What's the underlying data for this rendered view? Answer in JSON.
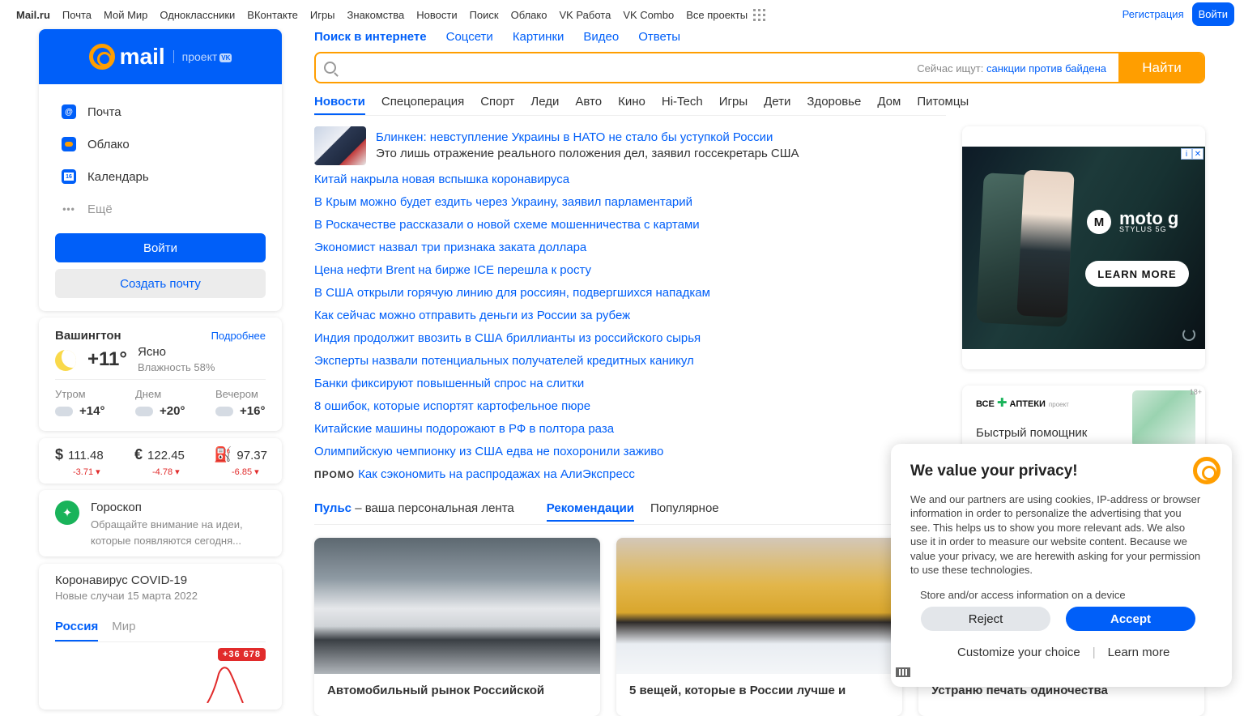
{
  "topbar": {
    "items": [
      "Mail.ru",
      "Почта",
      "Мой Мир",
      "Одноклассники",
      "ВКонтакте",
      "Игры",
      "Знакомства",
      "Новости",
      "Поиск",
      "Облако",
      "VK Работа",
      "VK Combo",
      "Все проекты"
    ],
    "register_label": "Регистрация",
    "login_label": "Войти"
  },
  "login_card": {
    "logo_text": "mail",
    "logo_project": "проект",
    "logo_vk": "VK",
    "services": [
      {
        "label": "Почта",
        "icon": "mail-icon",
        "color": "#005ff9"
      },
      {
        "label": "Облако",
        "icon": "cloud-icon",
        "color": "#005ff9"
      },
      {
        "label": "Календарь",
        "icon": "calendar-icon",
        "color": "#005ff9"
      },
      {
        "label": "Ещё",
        "icon": "more-icon"
      }
    ],
    "calendar_day": "16",
    "login_button": "Войти",
    "create_button": "Создать почту"
  },
  "weather": {
    "city": "Вашингтон",
    "more_link": "Подробнее",
    "temp_now": "+11°",
    "condition": "Ясно",
    "humidity": "Влажность 58%",
    "parts": [
      {
        "label": "Утром",
        "temp": "+14°"
      },
      {
        "label": "Днем",
        "temp": "+20°"
      },
      {
        "label": "Вечером",
        "temp": "+16°"
      }
    ]
  },
  "rates": [
    {
      "symbol": "$",
      "value": "111.48",
      "change": "-3.71 ▾"
    },
    {
      "symbol": "€",
      "value": "122.45",
      "change": "-4.78 ▾"
    },
    {
      "symbol": "oil-icon",
      "value": "97.37",
      "change": "-6.85 ▾"
    }
  ],
  "horoscope": {
    "title": "Гороскоп",
    "text": "Обращайте внимание на идеи, которые появляются сегодня..."
  },
  "covid": {
    "title": "Коронавирус COVID-19",
    "subtitle": "Новые случаи 15 марта 2022",
    "tabs": [
      "Россия",
      "Мир"
    ],
    "badge": "+36 678"
  },
  "search": {
    "tabs": [
      "Поиск в интернете",
      "Соцсети",
      "Картинки",
      "Видео",
      "Ответы"
    ],
    "hint_prefix": "Сейчас ищут:",
    "hint_query": "санкции против байдена",
    "button_label": "Найти"
  },
  "news": {
    "tabs": [
      "Новости",
      "Спецоперация",
      "Спорт",
      "Леди",
      "Авто",
      "Кино",
      "Hi-Tech",
      "Игры",
      "Дети",
      "Здоровье",
      "Дом",
      "Питомцы"
    ],
    "top": {
      "title": "Блинкен: невступление Украины в НАТО не стало бы уступкой России",
      "subtitle": "Это лишь отражение реального положения дел, заявил госсекретарь США"
    },
    "items": [
      "Китай накрыла новая вспышка коронавируса",
      "В Крым можно будет ездить через Украину, заявил парламентарий",
      "В Роскачестве рассказали о новой схеме мошенничества с картами",
      "Экономист назвал три признака заката доллара",
      "Цена нефти Brent на бирже ICE перешла к росту",
      "В США открыли горячую линию для россиян, подвергшихся нападкам",
      "Как сейчас можно отправить деньги из России за рубеж",
      "Индия продолжит ввозить в США бриллианты из российского сырья",
      "Эксперты назвали потенциальных получателей кредитных каникул",
      "Банки фиксируют повышенный спрос на слитки",
      "8 ошибок, которые испортят картофельное пюре",
      "Китайские машины подорожают в РФ в полтора раза",
      "Олимпийскую чемпионку из США едва не похоронили заживо"
    ],
    "promo_label": "ПРОМО",
    "promo_text": "Как сэкономить на распродажах на АлиЭкспресс"
  },
  "pulse": {
    "title_bold": "Пульс",
    "title_rest": " – ваша персональная лента",
    "tabs": [
      "Рекомендации",
      "Популярное"
    ],
    "cards": [
      {
        "title": "Автомобильный рынок Российской"
      },
      {
        "title": "5 вещей, которые в России лучше и"
      },
      {
        "title": "Устраню печать одиночества"
      }
    ]
  },
  "ads": {
    "moto_brand": "moto g",
    "moto_model": "STYLUS 5G",
    "moto_cta": "LEARN MORE",
    "apteki_logo": "ВСЕ",
    "apteki_logo2": "АПТЕКИ",
    "apteki_project": "проект",
    "apteki_age": "18+",
    "apteki_text": "Быстрый помощник"
  },
  "privacy": {
    "title": "We value your privacy!",
    "text": "We and our partners are using cookies, IP-address or browser information in order to personalize the advertising that you see. This helps us to show you more relevant ads. We also use it in order to measure our website content. Because we value your privacy, we are herewith asking for your permission to use these technologies.",
    "sub": "Store and/or access information on a device",
    "reject": "Reject",
    "accept": "Accept",
    "customize": "Customize your choice",
    "sep": "|",
    "learn_more": "Learn more"
  }
}
